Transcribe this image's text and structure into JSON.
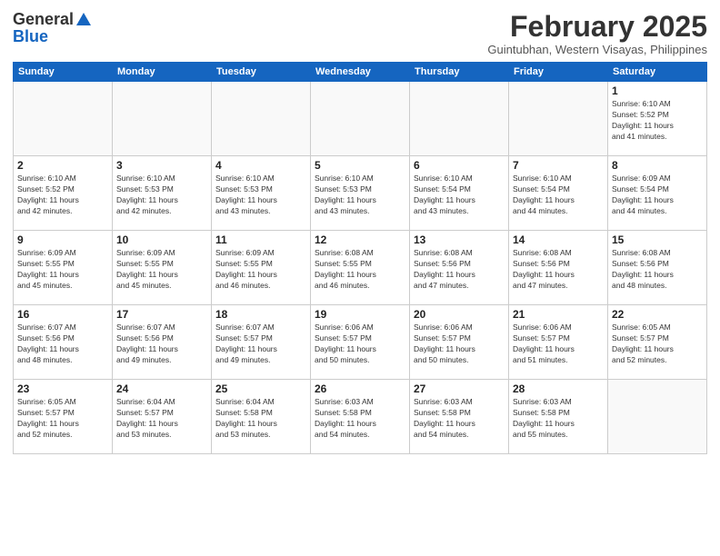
{
  "logo": {
    "general": "General",
    "blue": "Blue"
  },
  "header": {
    "month": "February 2025",
    "location": "Guintubhan, Western Visayas, Philippines"
  },
  "days_of_week": [
    "Sunday",
    "Monday",
    "Tuesday",
    "Wednesday",
    "Thursday",
    "Friday",
    "Saturday"
  ],
  "weeks": [
    [
      {
        "day": "",
        "info": ""
      },
      {
        "day": "",
        "info": ""
      },
      {
        "day": "",
        "info": ""
      },
      {
        "day": "",
        "info": ""
      },
      {
        "day": "",
        "info": ""
      },
      {
        "day": "",
        "info": ""
      },
      {
        "day": "1",
        "info": "Sunrise: 6:10 AM\nSunset: 5:52 PM\nDaylight: 11 hours\nand 41 minutes."
      }
    ],
    [
      {
        "day": "2",
        "info": "Sunrise: 6:10 AM\nSunset: 5:52 PM\nDaylight: 11 hours\nand 42 minutes."
      },
      {
        "day": "3",
        "info": "Sunrise: 6:10 AM\nSunset: 5:53 PM\nDaylight: 11 hours\nand 42 minutes."
      },
      {
        "day": "4",
        "info": "Sunrise: 6:10 AM\nSunset: 5:53 PM\nDaylight: 11 hours\nand 43 minutes."
      },
      {
        "day": "5",
        "info": "Sunrise: 6:10 AM\nSunset: 5:53 PM\nDaylight: 11 hours\nand 43 minutes."
      },
      {
        "day": "6",
        "info": "Sunrise: 6:10 AM\nSunset: 5:54 PM\nDaylight: 11 hours\nand 43 minutes."
      },
      {
        "day": "7",
        "info": "Sunrise: 6:10 AM\nSunset: 5:54 PM\nDaylight: 11 hours\nand 44 minutes."
      },
      {
        "day": "8",
        "info": "Sunrise: 6:09 AM\nSunset: 5:54 PM\nDaylight: 11 hours\nand 44 minutes."
      }
    ],
    [
      {
        "day": "9",
        "info": "Sunrise: 6:09 AM\nSunset: 5:55 PM\nDaylight: 11 hours\nand 45 minutes."
      },
      {
        "day": "10",
        "info": "Sunrise: 6:09 AM\nSunset: 5:55 PM\nDaylight: 11 hours\nand 45 minutes."
      },
      {
        "day": "11",
        "info": "Sunrise: 6:09 AM\nSunset: 5:55 PM\nDaylight: 11 hours\nand 46 minutes."
      },
      {
        "day": "12",
        "info": "Sunrise: 6:08 AM\nSunset: 5:55 PM\nDaylight: 11 hours\nand 46 minutes."
      },
      {
        "day": "13",
        "info": "Sunrise: 6:08 AM\nSunset: 5:56 PM\nDaylight: 11 hours\nand 47 minutes."
      },
      {
        "day": "14",
        "info": "Sunrise: 6:08 AM\nSunset: 5:56 PM\nDaylight: 11 hours\nand 47 minutes."
      },
      {
        "day": "15",
        "info": "Sunrise: 6:08 AM\nSunset: 5:56 PM\nDaylight: 11 hours\nand 48 minutes."
      }
    ],
    [
      {
        "day": "16",
        "info": "Sunrise: 6:07 AM\nSunset: 5:56 PM\nDaylight: 11 hours\nand 48 minutes."
      },
      {
        "day": "17",
        "info": "Sunrise: 6:07 AM\nSunset: 5:56 PM\nDaylight: 11 hours\nand 49 minutes."
      },
      {
        "day": "18",
        "info": "Sunrise: 6:07 AM\nSunset: 5:57 PM\nDaylight: 11 hours\nand 49 minutes."
      },
      {
        "day": "19",
        "info": "Sunrise: 6:06 AM\nSunset: 5:57 PM\nDaylight: 11 hours\nand 50 minutes."
      },
      {
        "day": "20",
        "info": "Sunrise: 6:06 AM\nSunset: 5:57 PM\nDaylight: 11 hours\nand 50 minutes."
      },
      {
        "day": "21",
        "info": "Sunrise: 6:06 AM\nSunset: 5:57 PM\nDaylight: 11 hours\nand 51 minutes."
      },
      {
        "day": "22",
        "info": "Sunrise: 6:05 AM\nSunset: 5:57 PM\nDaylight: 11 hours\nand 52 minutes."
      }
    ],
    [
      {
        "day": "23",
        "info": "Sunrise: 6:05 AM\nSunset: 5:57 PM\nDaylight: 11 hours\nand 52 minutes."
      },
      {
        "day": "24",
        "info": "Sunrise: 6:04 AM\nSunset: 5:57 PM\nDaylight: 11 hours\nand 53 minutes."
      },
      {
        "day": "25",
        "info": "Sunrise: 6:04 AM\nSunset: 5:58 PM\nDaylight: 11 hours\nand 53 minutes."
      },
      {
        "day": "26",
        "info": "Sunrise: 6:03 AM\nSunset: 5:58 PM\nDaylight: 11 hours\nand 54 minutes."
      },
      {
        "day": "27",
        "info": "Sunrise: 6:03 AM\nSunset: 5:58 PM\nDaylight: 11 hours\nand 54 minutes."
      },
      {
        "day": "28",
        "info": "Sunrise: 6:03 AM\nSunset: 5:58 PM\nDaylight: 11 hours\nand 55 minutes."
      },
      {
        "day": "",
        "info": ""
      }
    ]
  ]
}
